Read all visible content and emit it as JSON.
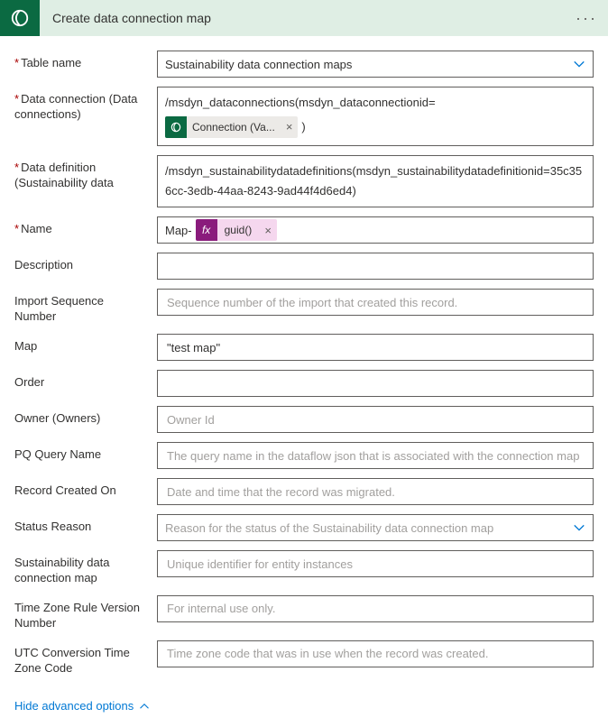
{
  "header": {
    "title": "Create data connection map"
  },
  "fields": {
    "tableName": {
      "label": "Table name",
      "value": "Sustainability data connection maps"
    },
    "dataConnection": {
      "label": "Data connection (Data connections)",
      "prefix": "/msdyn_dataconnections(msdyn_dataconnectionid=",
      "tokenLabel": "Connection (Va...",
      "suffix": ")"
    },
    "dataDefinition": {
      "label": "Data definition (Sustainability data",
      "value": "/msdyn_sustainabilitydatadefinitions(msdyn_sustainabilitydatadefinitionid=35c356cc-3edb-44aa-8243-9ad44f4d6ed4)"
    },
    "name": {
      "label": "Name",
      "prefix": "Map-",
      "tokenLabel": "guid()"
    },
    "description": {
      "label": "Description",
      "value": ""
    },
    "importSeq": {
      "label": "Import Sequence Number",
      "placeholder": "Sequence number of the import that created this record."
    },
    "map": {
      "label": "Map",
      "value": "\"test map\""
    },
    "order": {
      "label": "Order",
      "value": ""
    },
    "owner": {
      "label": "Owner (Owners)",
      "placeholder": "Owner Id"
    },
    "pqQuery": {
      "label": "PQ Query Name",
      "placeholder": "The query name in the dataflow json that is associated with the connection map"
    },
    "recordCreated": {
      "label": "Record Created On",
      "placeholder": "Date and time that the record was migrated."
    },
    "statusReason": {
      "label": "Status Reason",
      "placeholder": "Reason for the status of the Sustainability data connection map"
    },
    "sdcMap": {
      "label": "Sustainability data connection map",
      "placeholder": "Unique identifier for entity instances"
    },
    "tzRule": {
      "label": "Time Zone Rule Version Number",
      "placeholder": "For internal use only."
    },
    "utcConv": {
      "label": "UTC Conversion Time Zone Code",
      "placeholder": "Time zone code that was in use when the record was created."
    }
  },
  "footer": {
    "hideAdvanced": "Hide advanced options"
  },
  "fxIcon": "fx"
}
